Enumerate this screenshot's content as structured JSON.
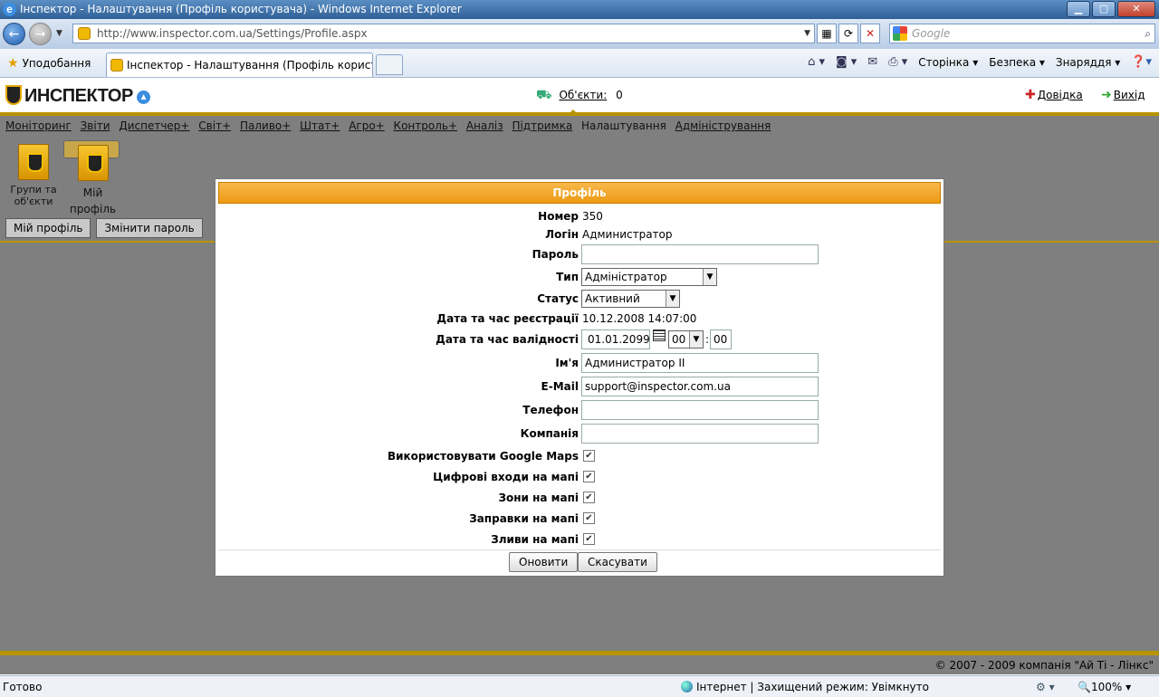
{
  "window": {
    "title": "Інспектор - Налаштування (Профіль користувача) - Windows Internet Explorer",
    "minimize": "▁",
    "maximize": "▢",
    "close": "✕"
  },
  "browser": {
    "url": "http://www.inspector.com.ua/Settings/Profile.aspx",
    "search_placeholder": "Google",
    "favorites_label": "Уподобання",
    "tab_title": "Інспектор - Налаштування (Профіль користув...",
    "commands": [
      "Сторінка",
      "Безпека",
      "Знаряддя"
    ],
    "status_ready": "Готово",
    "status_zone": "Інтернет | Захищений режим: Увімкнуто",
    "zoom": "100%"
  },
  "app": {
    "logo_text": "ИНСПЕКТОР",
    "objects_label": "Об'єкти:",
    "objects_count": "0",
    "help_label": "Довідка",
    "exit_label": "Вихід",
    "menu": [
      "Моніторинг",
      "Звіти",
      "Диспетчер+",
      "Світ+",
      "Паливо+",
      "Штат+",
      "Агро+",
      "Контроль+",
      "Аналіз",
      "Підтримка",
      "Налаштування",
      "Адміністрування"
    ],
    "icons": [
      {
        "label_line1": "Групи та",
        "label_line2": "об'єкти"
      },
      {
        "label_line1": "Мій",
        "label_line2": "профіль"
      }
    ],
    "subtabs": [
      "Мій профіль",
      "Змінити пароль"
    ],
    "copyright": "© 2007 - 2009 компанія \"Ай Ті - Лінкс\""
  },
  "dialog": {
    "title": "Профіль",
    "number_label": "Номер",
    "number_value": "350",
    "login_label": "Логін",
    "login_value": "Администратор",
    "password_label": "Пароль",
    "password_value": "",
    "type_label": "Тип",
    "type_value": "Адміністратор",
    "status_label": "Статус",
    "status_value": "Активний",
    "reg_label": "Дата та час реєстрації",
    "reg_value": "10.12.2008 14:07:00",
    "valid_label": "Дата та час валідності",
    "valid_date": "01.01.2099",
    "valid_hour": "00",
    "valid_sep": ":",
    "valid_min": "00",
    "name_label": "Ім'я",
    "name_value": "Администратор II",
    "email_label": "E-Mail",
    "email_value": "support@inspector.com.ua",
    "phone_label": "Телефон",
    "phone_value": "",
    "company_label": "Компанія",
    "company_value": "",
    "checkboxes": [
      {
        "label": "Використовувати Google Maps",
        "checked": true
      },
      {
        "label": "Цифрові входи на мапі",
        "checked": true
      },
      {
        "label": "Зони на мапі",
        "checked": true
      },
      {
        "label": "Заправки на мапі",
        "checked": true
      },
      {
        "label": "Зливи на мапі",
        "checked": true
      }
    ],
    "update_button": "Оновити",
    "cancel_button": "Скасувати"
  }
}
